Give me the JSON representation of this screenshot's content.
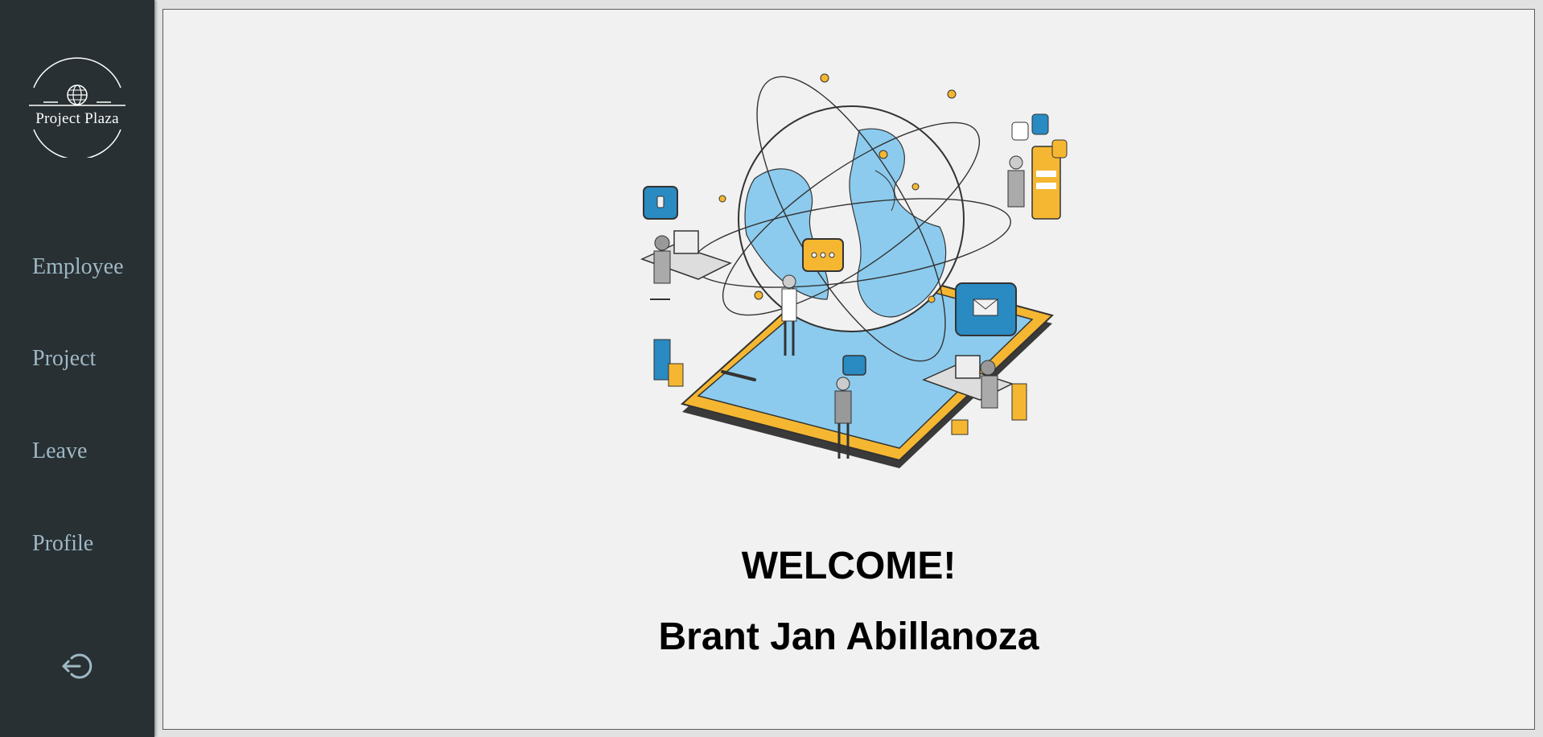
{
  "app": {
    "logo_text": "Project Plaza",
    "logo_icon": "globe-icon"
  },
  "sidebar": {
    "items": [
      {
        "label": "Employee"
      },
      {
        "label": "Project"
      },
      {
        "label": "Leave"
      },
      {
        "label": "Profile"
      }
    ],
    "logout_icon": "logout-icon"
  },
  "main": {
    "illustration": "globe-network-illustration",
    "welcome": "WELCOME!",
    "user_name": "Brant Jan Abillanoza"
  },
  "colors": {
    "sidebar_bg": "#283033",
    "nav_text": "#9fb8c4",
    "content_bg": "#f1f1f1",
    "accent_blue": "#8ccbed",
    "accent_dark_blue": "#2a8ac2",
    "accent_yellow": "#f5b731"
  }
}
